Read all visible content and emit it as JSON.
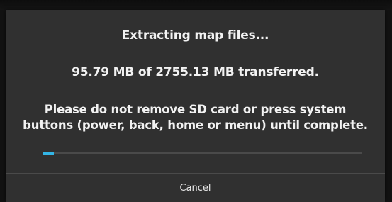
{
  "dialog": {
    "title": "Extracting map files...",
    "transferred_text": "95.79 MB of 2755.13 MB transferred.",
    "warning_line_1": "Please do not remove SD card or press system",
    "warning_line_2": "buttons (power, back, home or menu) until complete.",
    "progress": {
      "transferred_mb": 95.79,
      "total_mb": 2755.13,
      "fraction": 0.0348
    },
    "cancel_label": "Cancel"
  },
  "colors": {
    "dialog_background": "#303030",
    "screen_background": "#121212",
    "text": "#f2f2f2",
    "progress_accent": "#33b5e5",
    "progress_track": "#4a4a4a"
  }
}
